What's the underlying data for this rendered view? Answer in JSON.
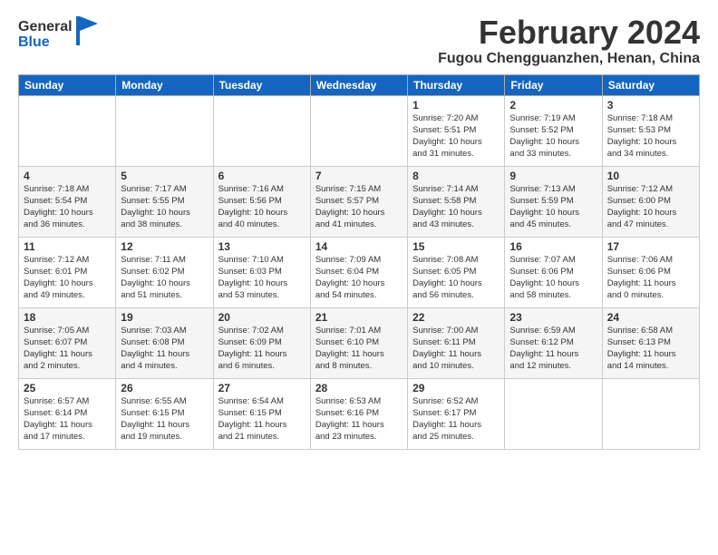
{
  "header": {
    "logo_general": "General",
    "logo_blue": "Blue",
    "title": "February 2024",
    "location": "Fugou Chengguanzhen, Henan, China"
  },
  "weekdays": [
    "Sunday",
    "Monday",
    "Tuesday",
    "Wednesday",
    "Thursday",
    "Friday",
    "Saturday"
  ],
  "weeks": [
    [
      {
        "day": "",
        "info": ""
      },
      {
        "day": "",
        "info": ""
      },
      {
        "day": "",
        "info": ""
      },
      {
        "day": "",
        "info": ""
      },
      {
        "day": "1",
        "info": "Sunrise: 7:20 AM\nSunset: 5:51 PM\nDaylight: 10 hours\nand 31 minutes."
      },
      {
        "day": "2",
        "info": "Sunrise: 7:19 AM\nSunset: 5:52 PM\nDaylight: 10 hours\nand 33 minutes."
      },
      {
        "day": "3",
        "info": "Sunrise: 7:18 AM\nSunset: 5:53 PM\nDaylight: 10 hours\nand 34 minutes."
      }
    ],
    [
      {
        "day": "4",
        "info": "Sunrise: 7:18 AM\nSunset: 5:54 PM\nDaylight: 10 hours\nand 36 minutes."
      },
      {
        "day": "5",
        "info": "Sunrise: 7:17 AM\nSunset: 5:55 PM\nDaylight: 10 hours\nand 38 minutes."
      },
      {
        "day": "6",
        "info": "Sunrise: 7:16 AM\nSunset: 5:56 PM\nDaylight: 10 hours\nand 40 minutes."
      },
      {
        "day": "7",
        "info": "Sunrise: 7:15 AM\nSunset: 5:57 PM\nDaylight: 10 hours\nand 41 minutes."
      },
      {
        "day": "8",
        "info": "Sunrise: 7:14 AM\nSunset: 5:58 PM\nDaylight: 10 hours\nand 43 minutes."
      },
      {
        "day": "9",
        "info": "Sunrise: 7:13 AM\nSunset: 5:59 PM\nDaylight: 10 hours\nand 45 minutes."
      },
      {
        "day": "10",
        "info": "Sunrise: 7:12 AM\nSunset: 6:00 PM\nDaylight: 10 hours\nand 47 minutes."
      }
    ],
    [
      {
        "day": "11",
        "info": "Sunrise: 7:12 AM\nSunset: 6:01 PM\nDaylight: 10 hours\nand 49 minutes."
      },
      {
        "day": "12",
        "info": "Sunrise: 7:11 AM\nSunset: 6:02 PM\nDaylight: 10 hours\nand 51 minutes."
      },
      {
        "day": "13",
        "info": "Sunrise: 7:10 AM\nSunset: 6:03 PM\nDaylight: 10 hours\nand 53 minutes."
      },
      {
        "day": "14",
        "info": "Sunrise: 7:09 AM\nSunset: 6:04 PM\nDaylight: 10 hours\nand 54 minutes."
      },
      {
        "day": "15",
        "info": "Sunrise: 7:08 AM\nSunset: 6:05 PM\nDaylight: 10 hours\nand 56 minutes."
      },
      {
        "day": "16",
        "info": "Sunrise: 7:07 AM\nSunset: 6:06 PM\nDaylight: 10 hours\nand 58 minutes."
      },
      {
        "day": "17",
        "info": "Sunrise: 7:06 AM\nSunset: 6:06 PM\nDaylight: 11 hours\nand 0 minutes."
      }
    ],
    [
      {
        "day": "18",
        "info": "Sunrise: 7:05 AM\nSunset: 6:07 PM\nDaylight: 11 hours\nand 2 minutes."
      },
      {
        "day": "19",
        "info": "Sunrise: 7:03 AM\nSunset: 6:08 PM\nDaylight: 11 hours\nand 4 minutes."
      },
      {
        "day": "20",
        "info": "Sunrise: 7:02 AM\nSunset: 6:09 PM\nDaylight: 11 hours\nand 6 minutes."
      },
      {
        "day": "21",
        "info": "Sunrise: 7:01 AM\nSunset: 6:10 PM\nDaylight: 11 hours\nand 8 minutes."
      },
      {
        "day": "22",
        "info": "Sunrise: 7:00 AM\nSunset: 6:11 PM\nDaylight: 11 hours\nand 10 minutes."
      },
      {
        "day": "23",
        "info": "Sunrise: 6:59 AM\nSunset: 6:12 PM\nDaylight: 11 hours\nand 12 minutes."
      },
      {
        "day": "24",
        "info": "Sunrise: 6:58 AM\nSunset: 6:13 PM\nDaylight: 11 hours\nand 14 minutes."
      }
    ],
    [
      {
        "day": "25",
        "info": "Sunrise: 6:57 AM\nSunset: 6:14 PM\nDaylight: 11 hours\nand 17 minutes."
      },
      {
        "day": "26",
        "info": "Sunrise: 6:55 AM\nSunset: 6:15 PM\nDaylight: 11 hours\nand 19 minutes."
      },
      {
        "day": "27",
        "info": "Sunrise: 6:54 AM\nSunset: 6:15 PM\nDaylight: 11 hours\nand 21 minutes."
      },
      {
        "day": "28",
        "info": "Sunrise: 6:53 AM\nSunset: 6:16 PM\nDaylight: 11 hours\nand 23 minutes."
      },
      {
        "day": "29",
        "info": "Sunrise: 6:52 AM\nSunset: 6:17 PM\nDaylight: 11 hours\nand 25 minutes."
      },
      {
        "day": "",
        "info": ""
      },
      {
        "day": "",
        "info": ""
      }
    ]
  ]
}
